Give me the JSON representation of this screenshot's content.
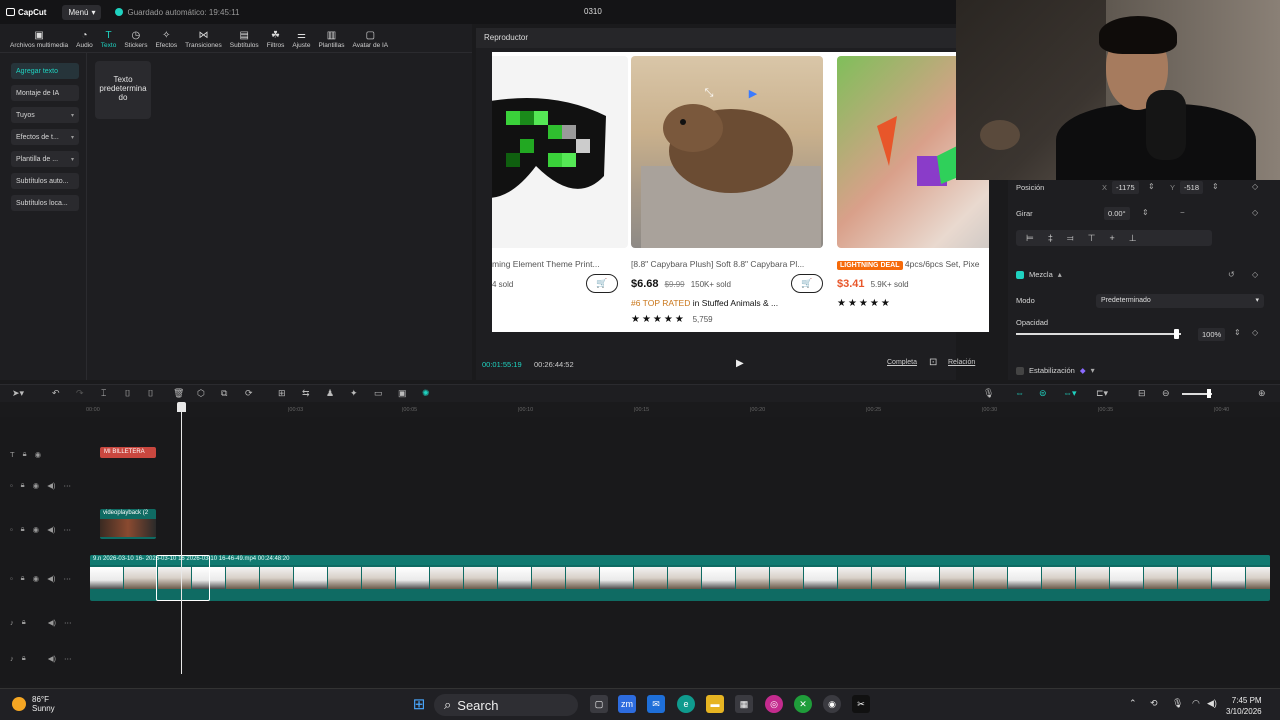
{
  "app": {
    "logo": "CapCut",
    "menu_label": "Menú",
    "autosave": "Guardado automático: 19:45:11",
    "project_name": "0310"
  },
  "toolbar": {
    "items": [
      {
        "label": "Archivos multimedia",
        "icon": "media-icon"
      },
      {
        "label": "Audio",
        "icon": "audio-icon"
      },
      {
        "label": "Texto",
        "icon": "text-icon",
        "active": true
      },
      {
        "label": "Stickers",
        "icon": "sticker-icon"
      },
      {
        "label": "Efectos",
        "icon": "effects-icon"
      },
      {
        "label": "Transiciones",
        "icon": "transition-icon"
      },
      {
        "label": "Subtítulos",
        "icon": "subtitles-icon"
      },
      {
        "label": "Filtros",
        "icon": "filter-icon"
      },
      {
        "label": "Ajuste",
        "icon": "adjust-icon"
      },
      {
        "label": "Plantillas",
        "icon": "templates-icon"
      },
      {
        "label": "Avatar de IA",
        "icon": "avatar-icon"
      }
    ]
  },
  "sidebar": {
    "items": [
      {
        "label": "Agregar texto"
      },
      {
        "label": "Montaje de IA"
      },
      {
        "label": "Tuyos"
      },
      {
        "label": "Efectos de t..."
      },
      {
        "label": "Plantilla de ..."
      },
      {
        "label": "Subtítulos auto..."
      },
      {
        "label": "Subtítulos loca..."
      }
    ]
  },
  "text_card": {
    "label": "Texto predetermina do"
  },
  "player": {
    "title": "Reproductor",
    "current_time": "00:01:55:19",
    "total_time": "00:26:44:52",
    "full_label": "Completa",
    "ratio_label": "Relación",
    "products": [
      {
        "title": "ming Element Theme Print...",
        "sold": "4 sold"
      },
      {
        "title": "[8.8\" Capybara Plush] Soft 8.8\" Capybara Pl...",
        "price": "$6.68",
        "old_price": "$9.99",
        "sold": "150K+ sold",
        "rank": "#6 TOP RATED",
        "rank_suffix": "in Stuffed Animals & ...",
        "reviews": "5,759"
      },
      {
        "deal": "LIGHTNING DEAL",
        "title": "4pcs/6pcs Set, Pixe",
        "price": "$3.41",
        "sold": "5.9K+ sold"
      }
    ]
  },
  "properties": {
    "position_label": "Posición",
    "x_label": "X",
    "x_value": "-1175",
    "y_label": "Y",
    "y_value": "-518",
    "rotate_label": "Girar",
    "rotate_value": "0.00°",
    "blend_label": "Mezcla",
    "mode_label": "Modo",
    "mode_value": "Predeterminado",
    "opacity_label": "Opacidad",
    "opacity_value": "100%",
    "opacity_level": 1.0,
    "stabilize_label": "Estabilización"
  },
  "timeline": {
    "ruler": [
      "00:00",
      "|00:03",
      "|00:05",
      "|00:10",
      "|00:15",
      "|00:20",
      "|00:25",
      "|00:30",
      "|00:35",
      "|00:40"
    ],
    "text_clip": "MI BILLETERA",
    "video_clip": "videoplayback (2",
    "main_clip_info": "9.n   2026-03-10 16-   2026-03-10 16   2026-03-10 16-46-49.mp4   00:24:48:20",
    "text_clip_color": "#c9473f",
    "main_clip_color": "#0f6b63"
  },
  "taskbar": {
    "temperature": "86°F",
    "condition": "Sunny",
    "search_label": "Search",
    "time": "7:45 PM",
    "date": "3/10/2026"
  }
}
